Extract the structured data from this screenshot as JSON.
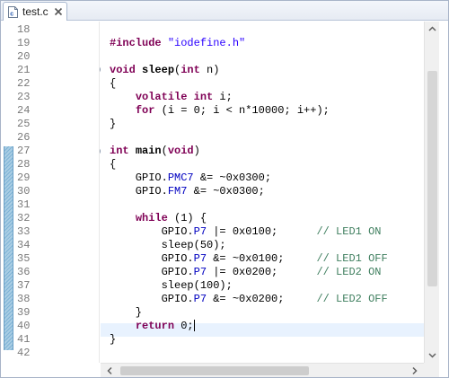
{
  "tab": {
    "label": "test.c",
    "file_icon": "c-source-file-icon",
    "close_icon": "close-icon"
  },
  "gutter": {
    "line_numbers": [
      "18",
      "19",
      "20",
      "21",
      "22",
      "23",
      "24",
      "25",
      "26",
      "27",
      "28",
      "29",
      "30",
      "31",
      "32",
      "33",
      "34",
      "35",
      "36",
      "37",
      "38",
      "39",
      "40",
      "41",
      "42"
    ],
    "modified_range": [
      "27",
      "41"
    ],
    "fold_markers": [
      "21",
      "27"
    ]
  },
  "code": {
    "lines": [
      {
        "num": "18",
        "segments": []
      },
      {
        "num": "19",
        "segments": [
          {
            "t": "#include ",
            "c": "kw"
          },
          {
            "t": "\"iodefine.h\"",
            "c": "str"
          }
        ]
      },
      {
        "num": "20",
        "segments": []
      },
      {
        "num": "21",
        "segments": [
          {
            "t": "void ",
            "c": "kw"
          },
          {
            "t": "sleep",
            "c": "fn"
          },
          {
            "t": "(",
            "c": ""
          },
          {
            "t": "int",
            "c": "kw"
          },
          {
            "t": " n)",
            "c": ""
          }
        ]
      },
      {
        "num": "22",
        "segments": [
          {
            "t": "{",
            "c": ""
          }
        ]
      },
      {
        "num": "23",
        "segments": [
          {
            "t": "    ",
            "c": ""
          },
          {
            "t": "volatile int",
            "c": "kw"
          },
          {
            "t": " i;",
            "c": ""
          }
        ]
      },
      {
        "num": "24",
        "segments": [
          {
            "t": "    ",
            "c": ""
          },
          {
            "t": "for",
            "c": "kw"
          },
          {
            "t": " (i = 0; i < n*10000; i++);",
            "c": ""
          }
        ]
      },
      {
        "num": "25",
        "segments": [
          {
            "t": "}",
            "c": ""
          }
        ]
      },
      {
        "num": "26",
        "segments": []
      },
      {
        "num": "27",
        "segments": [
          {
            "t": "int ",
            "c": "kw"
          },
          {
            "t": "main",
            "c": "fn"
          },
          {
            "t": "(",
            "c": ""
          },
          {
            "t": "void",
            "c": "kw"
          },
          {
            "t": ")",
            "c": ""
          }
        ]
      },
      {
        "num": "28",
        "segments": [
          {
            "t": "{",
            "c": ""
          }
        ]
      },
      {
        "num": "29",
        "segments": [
          {
            "t": "    GPIO.",
            "c": ""
          },
          {
            "t": "PMC7",
            "c": "fld"
          },
          {
            "t": " &= ~0x0300;",
            "c": ""
          }
        ]
      },
      {
        "num": "30",
        "segments": [
          {
            "t": "    GPIO.",
            "c": ""
          },
          {
            "t": "FM7",
            "c": "fld"
          },
          {
            "t": " &= ~0x0300;",
            "c": ""
          }
        ]
      },
      {
        "num": "31",
        "segments": []
      },
      {
        "num": "32",
        "segments": [
          {
            "t": "    ",
            "c": ""
          },
          {
            "t": "while",
            "c": "kw"
          },
          {
            "t": " (1) {",
            "c": ""
          }
        ]
      },
      {
        "num": "33",
        "segments": [
          {
            "t": "        GPIO.",
            "c": ""
          },
          {
            "t": "P7",
            "c": "fld"
          },
          {
            "t": " |= 0x0100;      ",
            "c": ""
          },
          {
            "t": "// LED1 ON",
            "c": "cmt"
          }
        ]
      },
      {
        "num": "34",
        "segments": [
          {
            "t": "        sleep(50);",
            "c": ""
          }
        ]
      },
      {
        "num": "35",
        "segments": [
          {
            "t": "        GPIO.",
            "c": ""
          },
          {
            "t": "P7",
            "c": "fld"
          },
          {
            "t": " &= ~0x0100;     ",
            "c": ""
          },
          {
            "t": "// LED1 OFF",
            "c": "cmt"
          }
        ]
      },
      {
        "num": "36",
        "segments": [
          {
            "t": "        GPIO.",
            "c": ""
          },
          {
            "t": "P7",
            "c": "fld"
          },
          {
            "t": " |= 0x0200;      ",
            "c": ""
          },
          {
            "t": "// LED2 ON",
            "c": "cmt"
          }
        ]
      },
      {
        "num": "37",
        "segments": [
          {
            "t": "        sleep(100);",
            "c": ""
          }
        ]
      },
      {
        "num": "38",
        "segments": [
          {
            "t": "        GPIO.",
            "c": ""
          },
          {
            "t": "P7",
            "c": "fld"
          },
          {
            "t": " &= ~0x0200;     ",
            "c": ""
          },
          {
            "t": "// LED2 OFF",
            "c": "cmt"
          }
        ]
      },
      {
        "num": "39",
        "segments": [
          {
            "t": "    }",
            "c": ""
          }
        ]
      },
      {
        "num": "40",
        "segments": [
          {
            "t": "    ",
            "c": ""
          },
          {
            "t": "return",
            "c": "kw"
          },
          {
            "t": " 0;",
            "c": ""
          }
        ],
        "current": true
      },
      {
        "num": "41",
        "segments": [
          {
            "t": "}",
            "c": ""
          }
        ]
      },
      {
        "num": "42",
        "segments": []
      }
    ]
  },
  "scrollbars": {
    "vertical": "vertical-scrollbar",
    "horizontal": "horizontal-scrollbar"
  }
}
